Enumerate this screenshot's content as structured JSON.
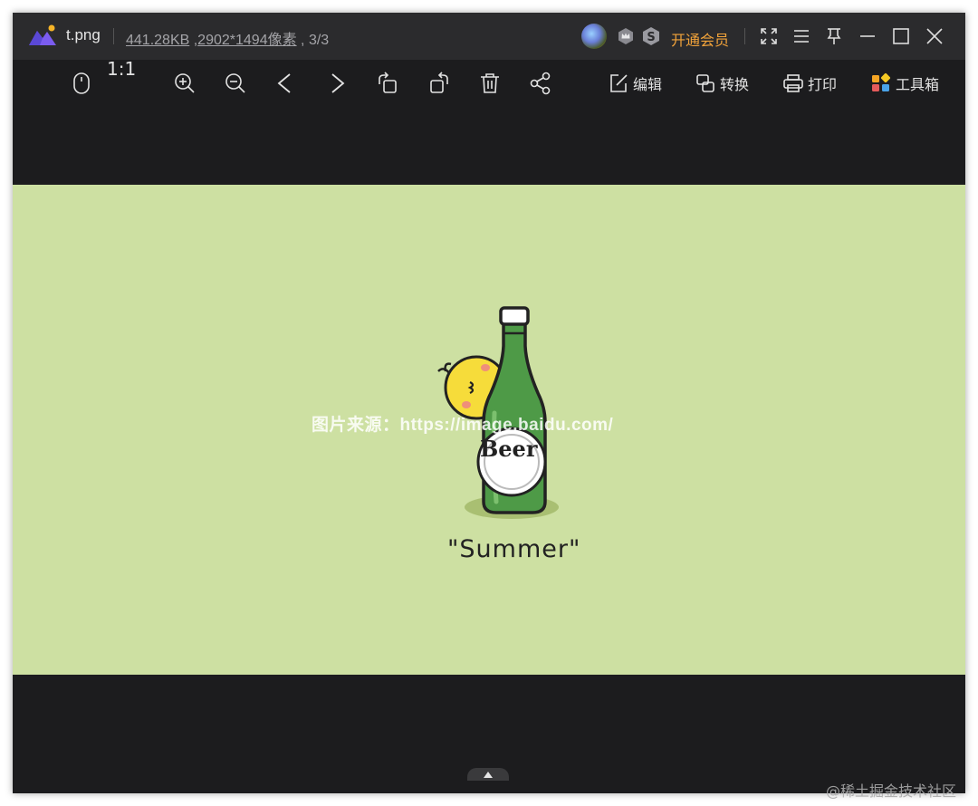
{
  "titlebar": {
    "filename": "t.png",
    "file_size": "441.28KB",
    "dimensions": "2902*1494像素",
    "position": "3/3",
    "vip_label": "开通会员",
    "accent_color": "#f2a33a"
  },
  "toolbar": {
    "ratio_label": "1:1",
    "edit_label": "编辑",
    "convert_label": "转换",
    "print_label": "打印",
    "toolbox_label": "工具箱"
  },
  "image": {
    "background_color": "#cde0a2",
    "watermark": "图片来源：https://image.baidu.com/",
    "bottle_label": "Beer",
    "caption": "\"Summer\""
  },
  "footer": {
    "community": "@稀土掘金技术社区"
  },
  "icons": [
    "app-logo-icon",
    "crown-badge-icon",
    "s-badge-icon",
    "fullscreen-icon",
    "menu-icon",
    "pin-icon",
    "minimize-icon",
    "maximize-icon",
    "close-icon",
    "mouse-icon",
    "zoom-in-icon",
    "zoom-out-icon",
    "prev-icon",
    "next-icon",
    "rotate-left-icon",
    "rotate-right-icon",
    "delete-icon",
    "share-icon",
    "edit-icon",
    "convert-icon",
    "print-icon",
    "toolbox-icon",
    "expand-up-icon"
  ]
}
